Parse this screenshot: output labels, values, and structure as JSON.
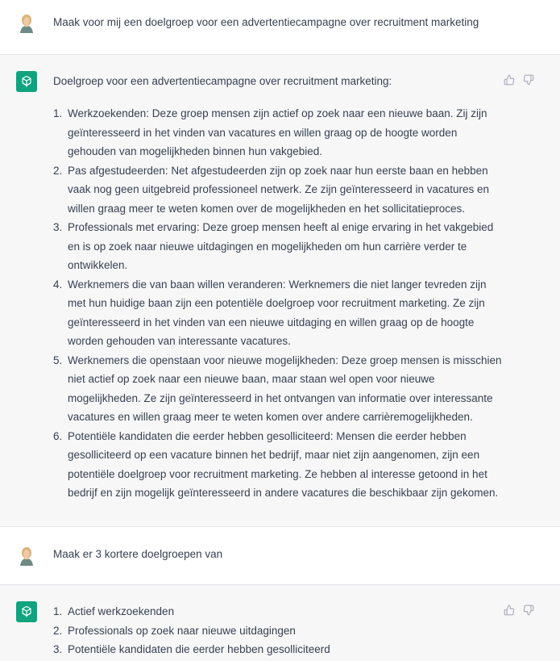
{
  "conversation": {
    "prompt1": "Maak voor mij een doelgroep voor een advertentiecampagne over recruitment marketing",
    "response1": {
      "intro": "Doelgroep voor een advertentiecampagne over recruitment marketing:",
      "items": [
        {
          "num": "1.",
          "lines": [
            "Werkzoekenden: Deze groep mensen zijn actief op zoek naar een nieuwe baan. Zij zijn",
            "geïnteresseerd in het vinden van vacatures en willen graag op de hoogte worden",
            "gehouden van mogelijkheden binnen hun vakgebied."
          ]
        },
        {
          "num": "2.",
          "lines": [
            "Pas afgestudeerden: Net afgestudeerden zijn op zoek naar hun eerste baan en hebben",
            "vaak nog geen uitgebreid professioneel netwerk. Ze zijn geïnteresseerd in vacatures en",
            "willen graag meer te weten komen over de mogelijkheden en het sollicitatieproces."
          ]
        },
        {
          "num": "3.",
          "lines": [
            "Professionals met ervaring: Deze groep mensen heeft al enige ervaring in het vakgebied",
            "en is op zoek naar nieuwe uitdagingen en mogelijkheden om hun carrière verder te",
            "ontwikkelen."
          ]
        },
        {
          "num": "4.",
          "lines": [
            "Werknemers die van baan willen veranderen: Werknemers die niet langer tevreden zijn",
            "met hun huidige baan zijn een potentiële doelgroep voor recruitment marketing. Ze zijn",
            "geïnteresseerd in het vinden van een nieuwe uitdaging en willen graag op de hoogte",
            "worden gehouden van interessante vacatures."
          ]
        },
        {
          "num": "5.",
          "lines": [
            "Werknemers die openstaan voor nieuwe mogelijkheden: Deze groep mensen is misschien",
            "niet actief op zoek naar een nieuwe baan, maar staan wel open voor nieuwe",
            "mogelijkheden. Ze zijn geïnteresseerd in het ontvangen van informatie over interessante",
            "vacatures en willen graag meer te weten komen over andere carrièremogelijkheden."
          ]
        },
        {
          "num": "6.",
          "lines": [
            "Potentiële kandidaten die eerder hebben gesolliciteerd: Mensen die eerder hebben",
            "gesolliciteerd op een vacature binnen het bedrijf, maar niet zijn aangenomen, zijn een",
            "potentiële doelgroep voor recruitment marketing. Ze hebben al interesse getoond in het",
            "bedrijf en zijn mogelijk geïnteresseerd in andere vacatures die beschikbaar zijn gekomen."
          ]
        }
      ]
    },
    "prompt2": "Maak er 3 kortere doelgroepen van",
    "response2": {
      "items": [
        {
          "num": "1.",
          "lines": [
            "Actief werkzoekenden"
          ]
        },
        {
          "num": "2.",
          "lines": [
            "Professionals op zoek naar nieuwe uitdagingen"
          ]
        },
        {
          "num": "3.",
          "lines": [
            "Potentiële kandidaten die eerder hebben gesolliciteerd"
          ]
        }
      ]
    }
  },
  "icons": {
    "user_avatar": "user-avatar",
    "bot_avatar": "openai-logo-icon",
    "thumbs_up": "thumbs-up-icon",
    "thumbs_down": "thumbs-down-icon"
  },
  "colors": {
    "assistant_bg": "#f7f7f8",
    "bot_avatar_bg": "#10a37f",
    "text": "#374151",
    "icon": "#acacbe"
  }
}
